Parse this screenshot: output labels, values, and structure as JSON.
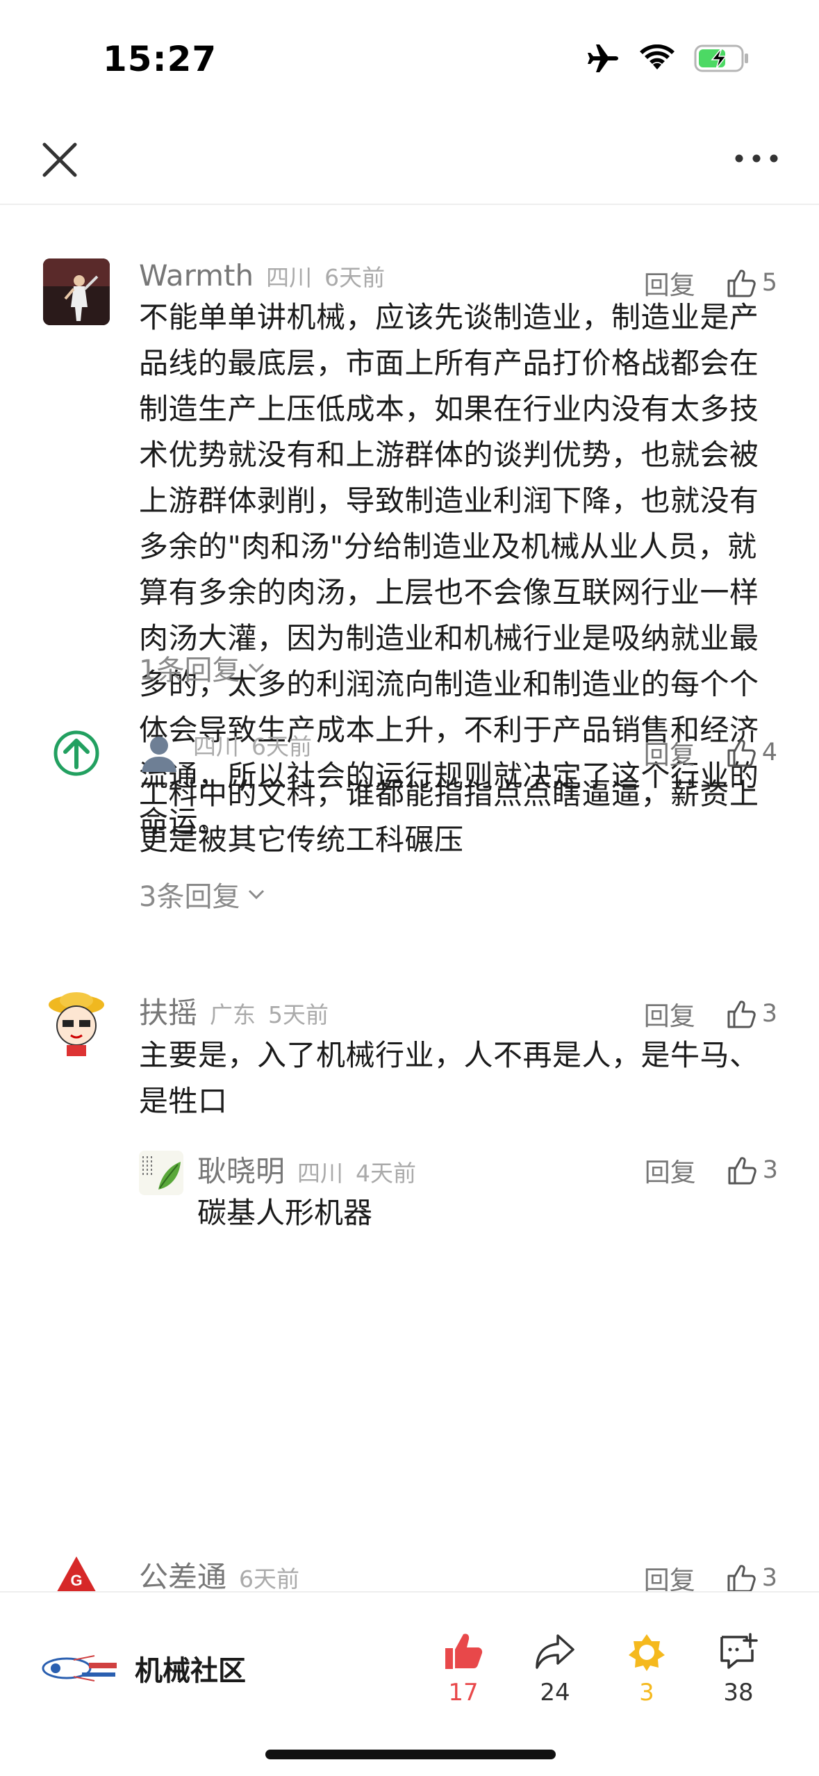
{
  "status_bar": {
    "time": "15:27",
    "battery_color": "#4cd964"
  },
  "nav": {
    "close_icon": "close-icon",
    "more_icon": "more-dots-icon"
  },
  "comments": [
    {
      "author": "Warmth",
      "location": "四川",
      "time": "6天前",
      "reply_label": "回复",
      "likes": "5",
      "body": "不能单单讲机械，应该先谈制造业，制造业是产品线的最底层，市面上所有产品打价格战都会在制造生产上压低成本，如果在行业内没有太多技术优势就没有和上游群体的谈判优势，也就会被上游群体剥削，导致制造业利润下降，也就没有多余的\"肉和汤\"分给制造业及机械从业人员，就算有多余的肉汤，上层也不会像互联网行业一样肉汤大灌，因为制造业和机械行业是吸纳就业最多的，太多的利润流向制造业和制造业的每个个体会导致生产成本上升，不利于产品销售和经济流通，所以社会的运行规则就决定了这个行业的命运。",
      "more_replies": "1条回复"
    },
    {
      "author": "",
      "location": "四川",
      "time": "6天前",
      "reply_label": "回复",
      "likes": "4",
      "body": "工科中的文科，谁都能指指点点瞎逼逼，薪资上更是被其它传统工科碾压",
      "more_replies": "3条回复"
    },
    {
      "author": "扶摇",
      "location": "广东",
      "time": "5天前",
      "reply_label": "回复",
      "likes": "3",
      "body": "主要是，入了机械行业，人不再是人，是牛马、是牲口",
      "sub_reply": {
        "author": "耿晓明",
        "location": "四川",
        "time": "4天前",
        "reply_label": "回复",
        "likes": "3",
        "body": "碳基人形机器"
      }
    },
    {
      "author": "公差通",
      "time": "6天前",
      "reply_label": "回复",
      "likes": "3"
    }
  ],
  "bottom_bar": {
    "community_name": "机械社区",
    "likes": "17",
    "shares": "24",
    "favorites": "3",
    "comments": "38",
    "like_color": "#e8484a",
    "favorite_color": "#f5b91e"
  }
}
